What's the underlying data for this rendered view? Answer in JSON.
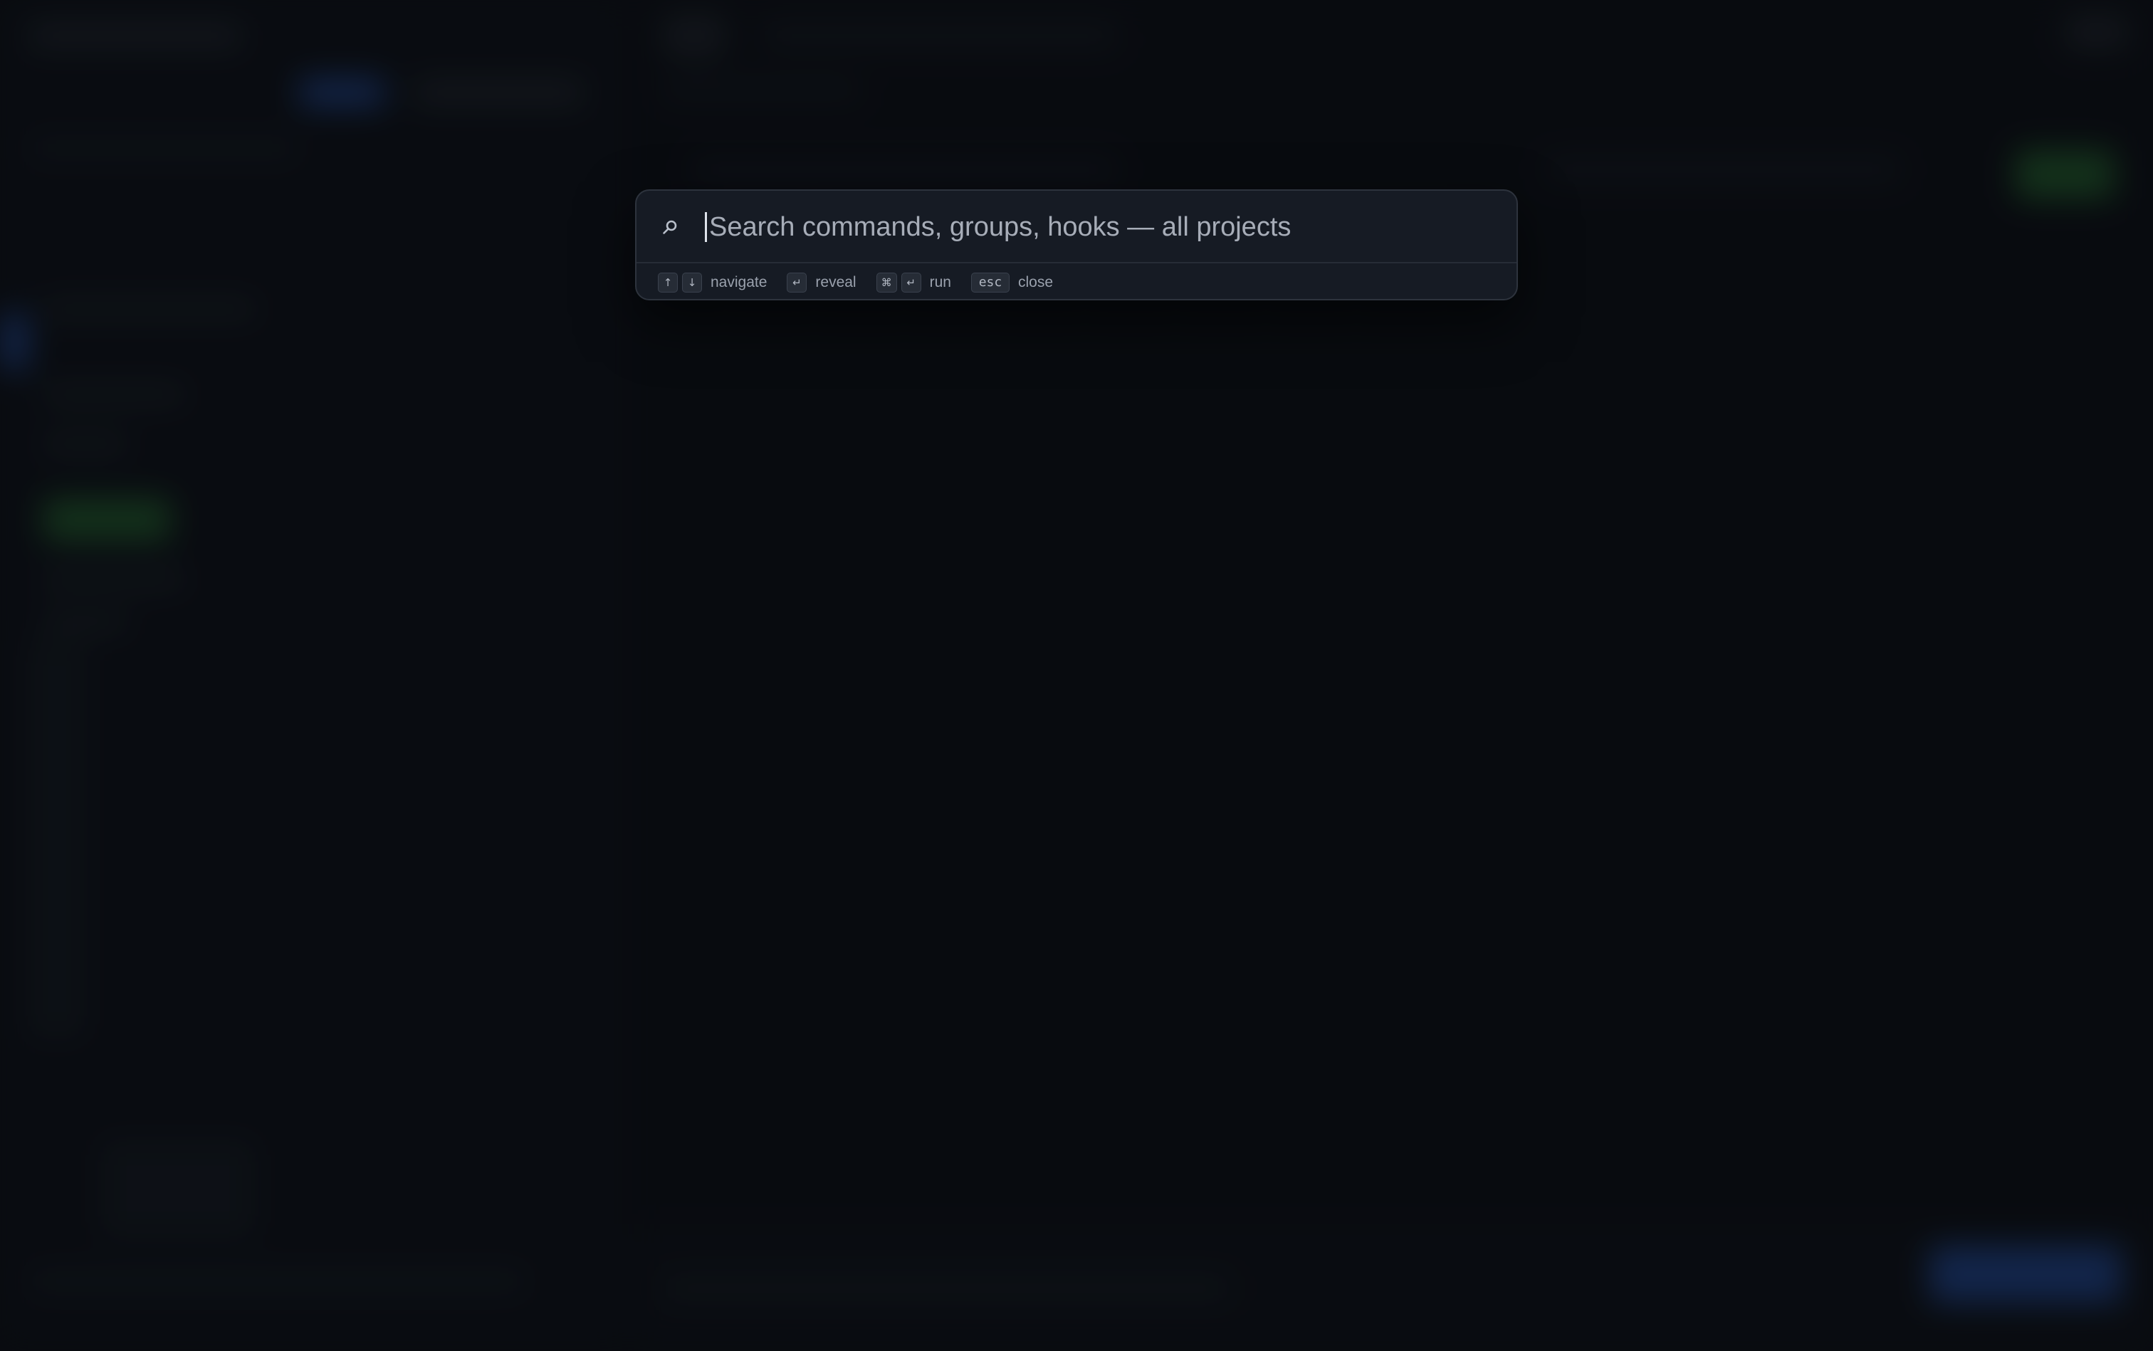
{
  "palette": {
    "search": {
      "placeholder": "Search commands, groups, hooks — all projects",
      "value": ""
    },
    "icons": {
      "search": "search-icon"
    },
    "hints": [
      {
        "keys": [
          "↑",
          "↓"
        ],
        "label": "navigate"
      },
      {
        "keys": [
          "↵"
        ],
        "label": "reveal"
      },
      {
        "keys": [
          "⌘",
          "↵"
        ],
        "label": "run"
      },
      {
        "keys": [
          "esc"
        ],
        "label": "close"
      }
    ]
  },
  "colors": {
    "background": "#0b0e14",
    "palette_bg": "#161b24",
    "palette_border": "#2d333d",
    "accent_blue": "#2c64d6",
    "accent_green": "#2f8a3a"
  }
}
